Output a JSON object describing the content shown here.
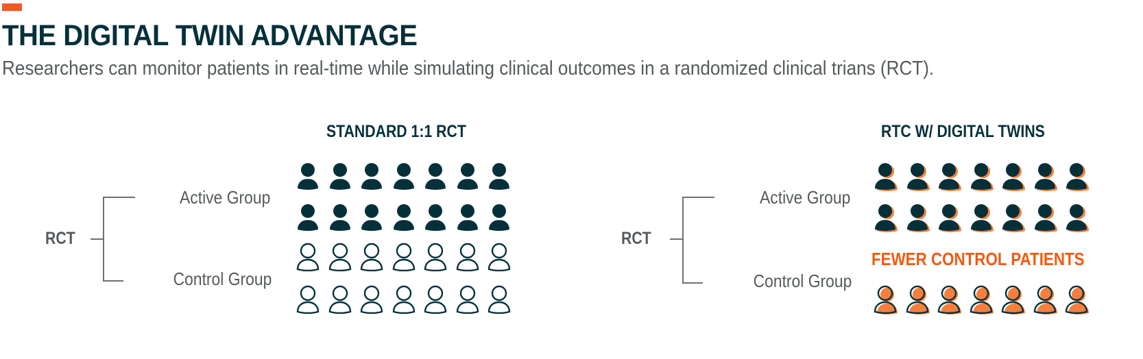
{
  "header": {
    "title": "THE DIGITAL TWIN ADVANTAGE",
    "subtitle": "Researchers can monitor patients in real-time while simulating clinical outcomes in a randomized clinical trians (RCT)."
  },
  "colors": {
    "dark": "#05303a",
    "orange": "#f25a0f",
    "orange_fill": "#f57f3e",
    "accent_bar": "#f05a28",
    "grey_text": "#555a5c"
  },
  "panels": [
    {
      "title": "STANDARD 1:1 RCT",
      "root_label": "RCT",
      "active_label": "Active Group",
      "control_label": "Control Group",
      "rows": [
        {
          "group": "active",
          "style": "filled-dark",
          "count": 7
        },
        {
          "group": "active",
          "style": "filled-dark",
          "count": 7
        },
        {
          "group": "control",
          "style": "outline-dark",
          "count": 7
        },
        {
          "group": "control",
          "style": "outline-dark",
          "count": 7
        }
      ]
    },
    {
      "title": "RTC W/ DIGITAL TWINS",
      "root_label": "RCT",
      "active_label": "Active Group",
      "control_label": "Control Group",
      "callout": "FEWER CONTROL PATIENTS",
      "rows": [
        {
          "group": "active",
          "style": "filled-dark-orange-shadow",
          "count": 7
        },
        {
          "group": "active",
          "style": "filled-dark-orange-shadow",
          "count": 7
        },
        {
          "group": "control",
          "style": "outline-dark-orange-fill",
          "count": 7
        }
      ]
    }
  ]
}
